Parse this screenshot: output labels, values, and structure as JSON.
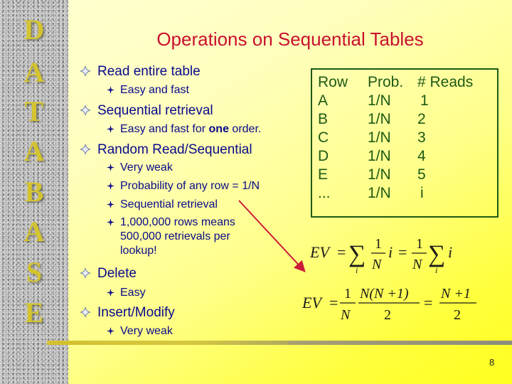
{
  "sidebar": {
    "letters": [
      "D",
      "A",
      "T",
      "A",
      "B",
      "A",
      "S",
      "E"
    ],
    "letter_color": "#d4c430"
  },
  "title": "Operations on Sequential Tables",
  "bullets": [
    {
      "label": "Read entire table",
      "sub": [
        {
          "parts": [
            {
              "text": "Easy and fast",
              "bold": false
            }
          ]
        }
      ]
    },
    {
      "label": "Sequential retrieval",
      "sub": [
        {
          "parts": [
            {
              "text": "Easy and fast for ",
              "bold": false
            },
            {
              "text": "one",
              "bold": true
            },
            {
              "text": " order.",
              "bold": false
            }
          ]
        }
      ]
    },
    {
      "label": "Random Read/Sequential",
      "sub": [
        {
          "parts": [
            {
              "text": "Very weak",
              "bold": false
            }
          ]
        },
        {
          "parts": [
            {
              "text": "Probability of any row = 1/N",
              "bold": false
            }
          ]
        },
        {
          "parts": [
            {
              "text": "Sequential retrieval",
              "bold": false
            }
          ]
        },
        {
          "parts": [
            {
              "text": "1,000,000 rows means 500,000 retrievals per lookup!",
              "bold": false
            }
          ]
        }
      ]
    },
    {
      "label": "Delete",
      "sub": [
        {
          "parts": [
            {
              "text": "Easy",
              "bold": false
            }
          ]
        }
      ]
    },
    {
      "label": "Insert/Modify",
      "sub": [
        {
          "parts": [
            {
              "text": "Very weak",
              "bold": false
            }
          ]
        }
      ]
    }
  ],
  "table": {
    "headers": [
      "Row",
      "Prob.",
      "# Reads"
    ],
    "rows": [
      [
        "A",
        "1/N",
        "1"
      ],
      [
        "B",
        "1/N",
        "2"
      ],
      [
        "C",
        "1/N",
        "3"
      ],
      [
        "D",
        "1/N",
        "4"
      ],
      [
        "E",
        "1/N",
        "5"
      ],
      [
        "...",
        "1/N",
        "i"
      ]
    ]
  },
  "formulas": {
    "ev_label": "EV",
    "eq": "=",
    "sum_symbol": "∑",
    "sum_index": "i",
    "one": "1",
    "n": "N",
    "i": "i",
    "n_n_plus_1": "N(N +1)",
    "n_plus_1": "N +1",
    "two": "2"
  },
  "colors": {
    "title": "#c8102e",
    "bullet_text": "#0a0a8c",
    "table": "#1e5a14",
    "arrow": "#cc1a3a"
  },
  "page_number": "8"
}
